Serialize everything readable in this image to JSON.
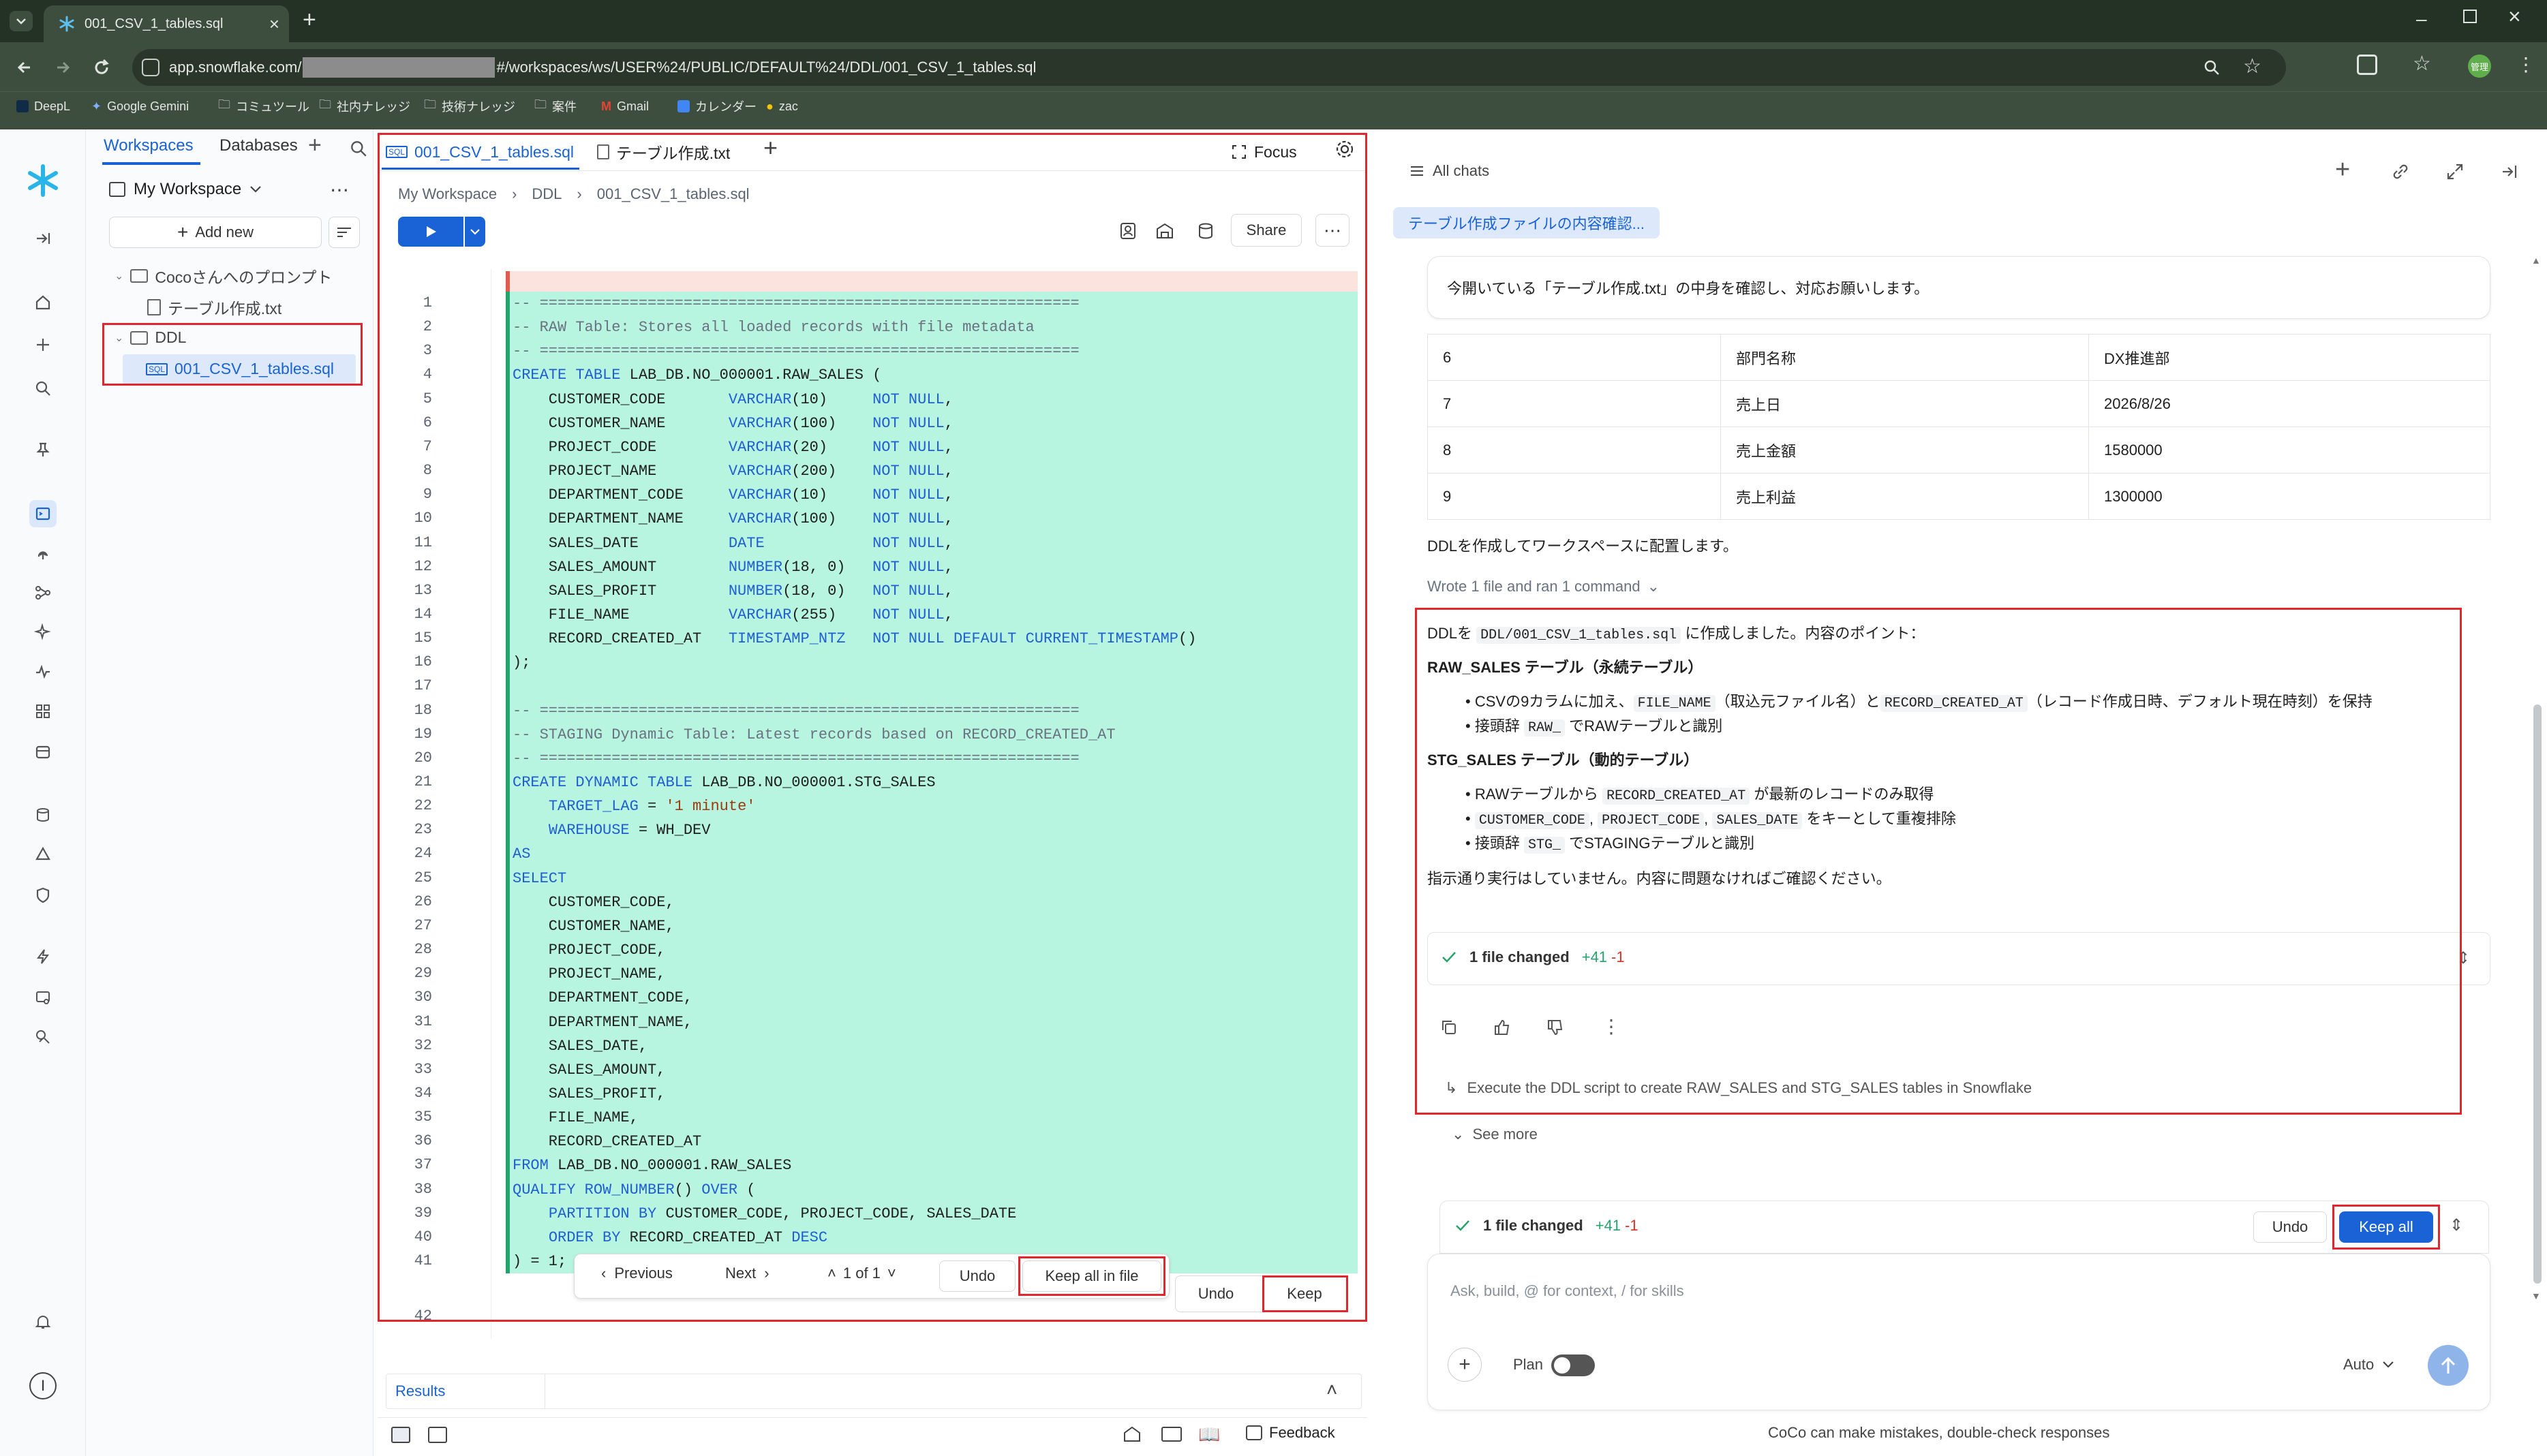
{
  "browser": {
    "tab_title": "001_CSV_1_tables.sql",
    "url_prefix": "app.snowflake.com/",
    "url_suffix": "#/workspaces/ws/USER%24/PUBLIC/DEFAULT%24/DDL/001_CSV_1_tables.sql",
    "bookmarks": [
      "DeepL",
      "Google Gemini",
      "コミュツール",
      "社内ナレッジ",
      "技術ナレッジ",
      "案件",
      "Gmail",
      "カレンダー",
      "zac"
    ],
    "profile_label": "管理"
  },
  "workspace": {
    "tabs": [
      "Workspaces",
      "Databases"
    ],
    "name": "My Workspace",
    "add_new": "Add new",
    "tree": [
      {
        "type": "folder",
        "label": "Cocoさんへのプロンプト"
      },
      {
        "type": "file",
        "label": "テーブル作成.txt"
      },
      {
        "type": "folder",
        "label": "DDL"
      },
      {
        "type": "file",
        "label": "001_CSV_1_tables.sql"
      }
    ]
  },
  "editor": {
    "tabs": [
      "001_CSV_1_tables.sql",
      "テーブル作成.txt"
    ],
    "focus_label": "Focus",
    "breadcrumb": [
      "My Workspace",
      "DDL",
      "001_CSV_1_tables.sql"
    ],
    "share_label": "Share",
    "code_lines": [
      "-- ============================================================",
      "-- RAW Table: Stores all loaded records with file metadata",
      "-- ============================================================",
      "CREATE TABLE LAB_DB.NO_000001.RAW_SALES (",
      "    CUSTOMER_CODE       VARCHAR(10)     NOT NULL,",
      "    CUSTOMER_NAME       VARCHAR(100)    NOT NULL,",
      "    PROJECT_CODE        VARCHAR(20)     NOT NULL,",
      "    PROJECT_NAME        VARCHAR(200)    NOT NULL,",
      "    DEPARTMENT_CODE     VARCHAR(10)     NOT NULL,",
      "    DEPARTMENT_NAME     VARCHAR(100)    NOT NULL,",
      "    SALES_DATE          DATE            NOT NULL,",
      "    SALES_AMOUNT        NUMBER(18, 0)   NOT NULL,",
      "    SALES_PROFIT        NUMBER(18, 0)   NOT NULL,",
      "    FILE_NAME           VARCHAR(255)    NOT NULL,",
      "    RECORD_CREATED_AT   TIMESTAMP_NTZ   NOT NULL DEFAULT CURRENT_TIMESTAMP()",
      ");",
      "",
      "-- ============================================================",
      "-- STAGING Dynamic Table: Latest records based on RECORD_CREATED_AT",
      "-- ============================================================",
      "CREATE DYNAMIC TABLE LAB_DB.NO_000001.STG_SALES",
      "    TARGET_LAG = '1 minute'",
      "    WAREHOUSE = WH_DEV",
      "AS",
      "SELECT",
      "    CUSTOMER_CODE,",
      "    CUSTOMER_NAME,",
      "    PROJECT_CODE,",
      "    PROJECT_NAME,",
      "    DEPARTMENT_CODE,",
      "    DEPARTMENT_NAME,",
      "    SALES_DATE,",
      "    SALES_AMOUNT,",
      "    SALES_PROFIT,",
      "    FILE_NAME,",
      "    RECORD_CREATED_AT",
      "FROM LAB_DB.NO_000001.RAW_SALES",
      "QUALIFY ROW_NUMBER() OVER (",
      "    PARTITION BY CUSTOMER_CODE, PROJECT_CODE, SALES_DATE",
      "    ORDER BY RECORD_CREATED_AT DESC",
      ") = 1;"
    ],
    "line_numbers": [
      "1",
      "2",
      "3",
      "4",
      "5",
      "6",
      "7",
      "8",
      "9",
      "10",
      "11",
      "12",
      "13",
      "14",
      "15",
      "16",
      "17",
      "18",
      "19",
      "20",
      "21",
      "22",
      "23",
      "24",
      "25",
      "26",
      "27",
      "28",
      "29",
      "30",
      "31",
      "32",
      "33",
      "34",
      "35",
      "36",
      "37",
      "38",
      "39",
      "40",
      "41",
      "42"
    ],
    "diff_bar": {
      "previous": "Previous",
      "next": "Next",
      "counter": "1 of 1",
      "undo": "Undo",
      "keep_all_in_file": "Keep all in file"
    },
    "hunk_bar": {
      "undo": "Undo",
      "keep": "Keep"
    },
    "results_label": "Results",
    "feedback_label": "Feedback"
  },
  "chat": {
    "all_chats": "All chats",
    "chat_title": "テーブル作成ファイルの内容確認...",
    "user_message": "今開いている「テーブル作成.txt」の中身を確認し、対応お願いします。",
    "table_rows": [
      [
        "6",
        "部門名称",
        "DX推進部"
      ],
      [
        "7",
        "売上日",
        "2026/8/26"
      ],
      [
        "8",
        "売上金額",
        "1580000"
      ],
      [
        "9",
        "売上利益",
        "1300000"
      ]
    ],
    "ddl_note": "DDLを作成してワークスペースに配置します。",
    "wrote_summary": "Wrote 1 file and ran 1 command",
    "answer": {
      "intro_a": "DDLを",
      "intro_code": "DDL/001_CSV_1_tables.sql",
      "intro_b": "に作成しました。内容のポイント：",
      "raw_heading": "RAW_SALES テーブル（永続テーブル）",
      "raw_b1_a": "CSVの9カラムに加え、",
      "raw_b1_code1": "FILE_NAME",
      "raw_b1_b": "（取込元ファイル名）と",
      "raw_b1_code2": "RECORD_CREATED_AT",
      "raw_b1_c": "（レコード作成日時、デフォルト現在時刻）を保持",
      "raw_b2_a": "接頭辞",
      "raw_b2_code": "RAW_",
      "raw_b2_b": "でRAWテーブルと識別",
      "stg_heading": "STG_SALES テーブル（動的テーブル）",
      "stg_b1_a": "RAWテーブルから",
      "stg_b1_code": "RECORD_CREATED_AT",
      "stg_b1_b": "が最新のレコードのみ取得",
      "stg_b2_code1": "CUSTOMER_CODE",
      "stg_b2_code2": "PROJECT_CODE",
      "stg_b2_code3": "SALES_DATE",
      "stg_b2_b": "をキーとして重複排除",
      "stg_b3_a": "接頭辞",
      "stg_b3_code": "STG_",
      "stg_b3_b": "でSTAGINGテーブルと識別",
      "closing": "指示通り実行はしていません。内容に問題なければご確認ください。"
    },
    "files_changed": "1 file changed",
    "added": "+41",
    "removed": "-1",
    "suggestion": "Execute the DDL script to create RAW_SALES and STG_SALES tables in Snowflake",
    "see_more": "See more",
    "bottom_undo": "Undo",
    "keep_all": "Keep all",
    "input_placeholder": "Ask, build, @ for context, / for skills",
    "plan_label": "Plan",
    "auto_label": "Auto",
    "disclaimer": "CoCo can make mistakes, double-check responses"
  },
  "colors": {
    "accent": "#1a63d6",
    "diff_added_bg": "#b8f5e1",
    "diff_removed_bg": "#fde3de",
    "highlight_box": "#e0262e",
    "browser_frame": "#243125"
  }
}
